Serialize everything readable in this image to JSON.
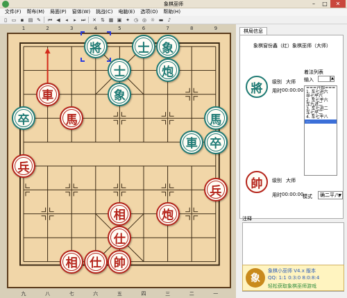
{
  "window": {
    "title": "象棋巫师",
    "min": "–",
    "max": "□",
    "close": "✕"
  },
  "menu": [
    "文件(F)",
    "帮布(M)",
    "局面(P)",
    "窗体(W)",
    "挑战(C)",
    "电脑(E)",
    "选项(O)",
    "帮助(H)"
  ],
  "toolbar_icons": [
    "new-icon",
    "open-icon",
    "save-icon",
    "print-icon",
    "edit-icon",
    "first-icon",
    "prev-icon",
    "back-icon",
    "forward-icon",
    "last-icon",
    "delete-icon",
    "flip-icon",
    "board-icon",
    "image-icon",
    "think-icon",
    "clock-icon",
    "analyze-icon",
    "hint-icon",
    "monitor-icon",
    "sound-icon"
  ],
  "board": {
    "top_coords": [
      "1",
      "2",
      "3",
      "4",
      "5",
      "6",
      "7",
      "8",
      "9"
    ],
    "bottom_coords": [
      "九",
      "八",
      "七",
      "六",
      "五",
      "四",
      "三",
      "二",
      "一"
    ],
    "last_move": {
      "from_file": 1,
      "from_rank": 3,
      "to_file": 1,
      "to_rank": 0
    },
    "selected": {
      "file": 3,
      "rank": 0
    },
    "pieces": [
      {
        "side": "green",
        "label": "將",
        "file": 3,
        "rank": 0
      },
      {
        "side": "green",
        "label": "士",
        "file": 5,
        "rank": 0
      },
      {
        "side": "green",
        "label": "象",
        "file": 6,
        "rank": 0
      },
      {
        "side": "green",
        "label": "士",
        "file": 4,
        "rank": 1
      },
      {
        "side": "green",
        "label": "炮",
        "file": 6,
        "rank": 1
      },
      {
        "side": "green",
        "label": "象",
        "file": 4,
        "rank": 2
      },
      {
        "side": "red",
        "label": "車",
        "file": 1,
        "rank": 2
      },
      {
        "side": "green",
        "label": "卒",
        "file": 0,
        "rank": 3
      },
      {
        "side": "red",
        "label": "馬",
        "file": 2,
        "rank": 3
      },
      {
        "side": "green",
        "label": "馬",
        "file": 8,
        "rank": 3
      },
      {
        "side": "green",
        "label": "車",
        "file": 7,
        "rank": 4
      },
      {
        "side": "green",
        "label": "卒",
        "file": 8,
        "rank": 4
      },
      {
        "side": "red",
        "label": "兵",
        "file": 0,
        "rank": 5
      },
      {
        "side": "red",
        "label": "兵",
        "file": 8,
        "rank": 6
      },
      {
        "side": "red",
        "label": "相",
        "file": 4,
        "rank": 7
      },
      {
        "side": "red",
        "label": "炮",
        "file": 6,
        "rank": 7
      },
      {
        "side": "red",
        "label": "仕",
        "file": 4,
        "rank": 8
      },
      {
        "side": "red",
        "label": "相",
        "file": 2,
        "rank": 9
      },
      {
        "side": "red",
        "label": "仕",
        "file": 3,
        "rank": 9
      },
      {
        "side": "red",
        "label": "帥",
        "file": 4,
        "rank": 9
      }
    ]
  },
  "panel": {
    "tab_label": "棋局信息",
    "match_title": "象棋窗份鑫（红）象棋巫师（大师）",
    "black": {
      "piece": "將",
      "level_label": "级别",
      "level": "大师",
      "time_label": "用时",
      "time": "00:00:00"
    },
    "red": {
      "piece": "帥",
      "level_label": "级别",
      "level": "大师",
      "time_label": "用时",
      "time": "00:00:00"
    },
    "movelist_label": "着法列表",
    "input_label": "输入",
    "moves": [
      "===开始===",
      "1. 车七进六",
      "   卒七平六",
      "2. 车七平六",
      "   车九进二",
      "3. 车七进二",
      "   车七平二",
      "4. 车七平八",
      "   ..."
    ],
    "selected_move_index": 8,
    "mode_label": "模式",
    "mode_value": "确二平八",
    "notes_label": "注释"
  },
  "banner": {
    "logo": "象",
    "line1": "象棋小巫师 V4.x 版本",
    "line2": "QQ: 1:1 0:3:0 8:0:8:4",
    "line3": "轻松获取象棋巫师游戏"
  },
  "colors": {
    "red_piece": "#b5231a",
    "green_piece": "#1e7a74",
    "board": "#f1d6a8",
    "arrow": "#d32a1a"
  }
}
